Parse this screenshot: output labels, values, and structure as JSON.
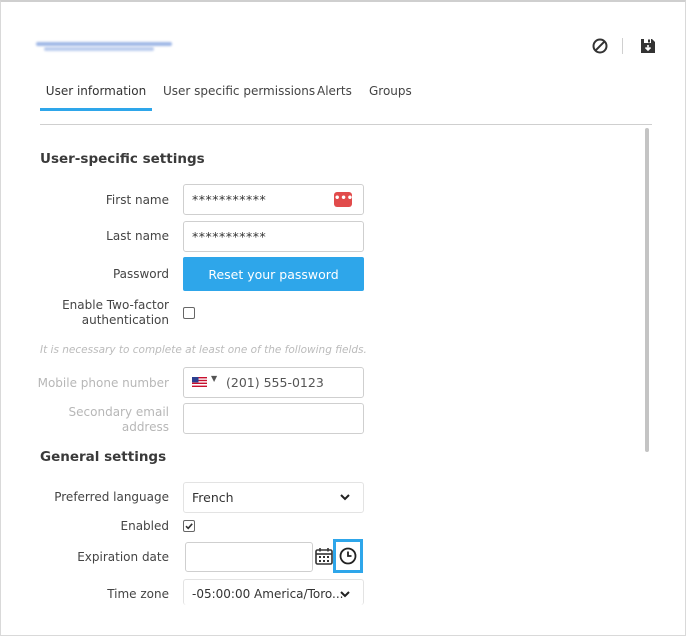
{
  "tabs": [
    {
      "label": "User information",
      "active": true
    },
    {
      "label": "User specific permissions",
      "active": false
    },
    {
      "label": "Alerts",
      "active": false
    },
    {
      "label": "Groups",
      "active": false
    }
  ],
  "icons": {
    "cancel": "cancel-icon",
    "save": "save-icon",
    "password_manager": "password-manager-icon",
    "calendar": "calendar-icon",
    "clock": "clock-icon",
    "flag": "us-flag-icon"
  },
  "colors": {
    "accent": "#2ea6ea",
    "danger": "#e14b4b"
  },
  "user_settings": {
    "title": "User-specific settings",
    "first_name_label": "First name",
    "first_name_value": "***********",
    "last_name_label": "Last name",
    "last_name_value": "***********",
    "password_label": "Password",
    "reset_password_label": "Reset your password",
    "two_factor_label_line1": "Enable Two-factor",
    "two_factor_label_line2": "authentication",
    "two_factor_checked": false,
    "required_note": "It is necessary to complete at least one of the following fields.",
    "mobile_label": "Mobile phone number",
    "mobile_placeholder": "(201) 555-0123",
    "secondary_email_label_line1": "Secondary email",
    "secondary_email_label_line2": "address",
    "secondary_email_value": ""
  },
  "general_settings": {
    "title": "General settings",
    "language_label": "Preferred language",
    "language_value": "French",
    "enabled_label": "Enabled",
    "enabled_checked": true,
    "expiration_label": "Expiration date",
    "expiration_value": "",
    "timezone_label": "Time zone",
    "timezone_value": "-05:00:00 America/Toro..."
  }
}
